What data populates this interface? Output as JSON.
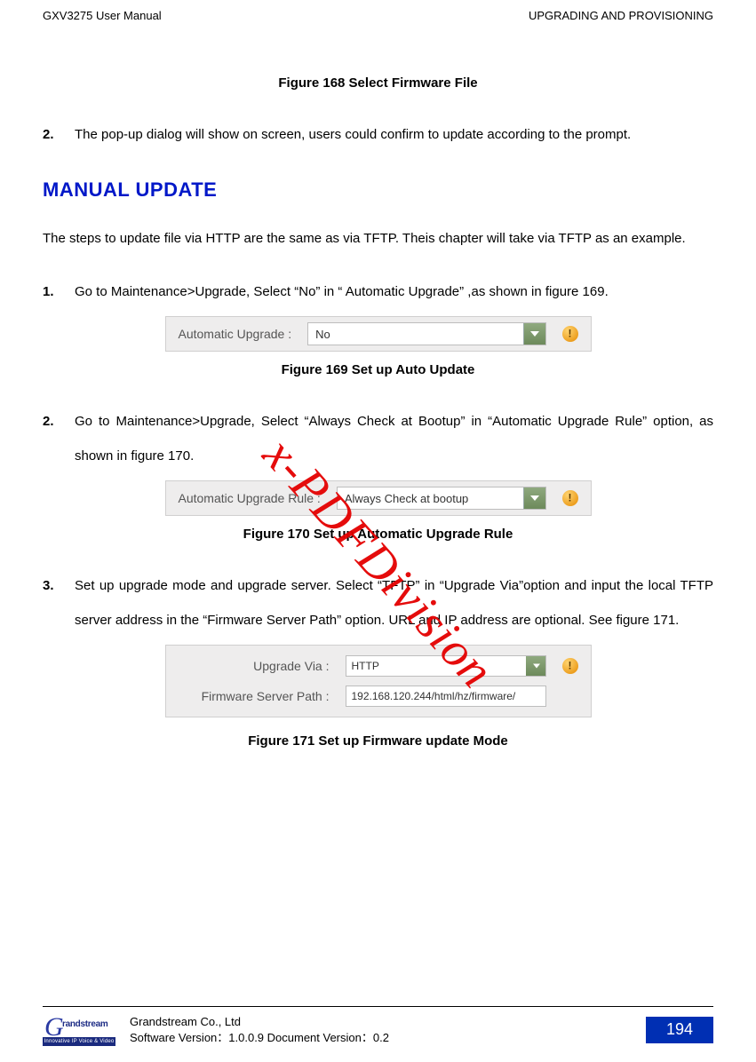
{
  "header": {
    "left": "GXV3275 User Manual",
    "right": "UPGRADING AND PROVISIONING"
  },
  "captions": {
    "fig168": "Figure 168 Select Firmware File",
    "fig169": "Figure 169 Set up Auto Update",
    "fig170": "Figure 170 Set up Automatic Upgrade Rule",
    "fig171": "Figure 171 Set up Firmware update Mode"
  },
  "list_top": {
    "n2": "2.",
    "t2": "The pop-up dialog will show on screen, users could confirm to update according to the prompt."
  },
  "heading": "MANUAL UPDATE",
  "intro": "The steps to update file via HTTP are the same as via TFTP. Theis chapter will take via TFTP as an example.",
  "steps": {
    "n1": "1.",
    "t1": "Go to Maintenance>Upgrade, Select “No” in “ Automatic Upgrade” ,as shown in figure 169.",
    "n2": "2.",
    "t2": "Go to Maintenance>Upgrade, Select “Always Check at Bootup” in “Automatic Upgrade Rule” option, as shown in figure 170.",
    "n3": "3.",
    "t3": "Set up upgrade mode and upgrade server. Select “TFTP” in “Upgrade Via”option and input the local TFTP server address in the “Firmware Server Path” option. URL and IP address are optional. See figure 171."
  },
  "fig169": {
    "label": "Automatic Upgrade :",
    "value": "No"
  },
  "fig170": {
    "label": "Automatic Upgrade Rule :",
    "value": "Always Check at bootup"
  },
  "fig171": {
    "label1": "Upgrade Via :",
    "value1": "HTTP",
    "label2": "Firmware Server Path :",
    "value2": "192.168.120.244/html/hz/firmware/"
  },
  "watermark": "x-PDFDivision",
  "footer": {
    "brand_g": "G",
    "brand_name": "randstream",
    "brand_bar": "Innovative IP Voice & Video",
    "line1": "Grandstream Co., Ltd",
    "line2": "Software Version：1.0.0.9 Document Version：0.2",
    "page": "194"
  }
}
